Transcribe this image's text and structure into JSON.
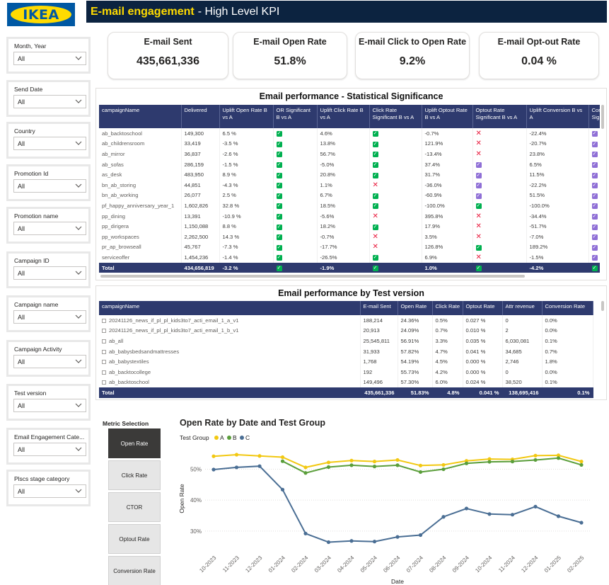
{
  "header": {
    "logo_text": "IKEA",
    "title_bold": "E-mail engagement",
    "title_rest": "- High Level KPI"
  },
  "slicers": [
    {
      "label": "Month, Year",
      "value": "All"
    },
    {
      "label": "Send Date",
      "value": "All"
    },
    {
      "label": "Country",
      "value": "All"
    },
    {
      "label": "Promotion Id",
      "value": "All"
    },
    {
      "label": "Promotion name",
      "value": "All"
    },
    {
      "label": "Campaign ID",
      "value": "All"
    },
    {
      "label": "Campaign name",
      "value": "All"
    },
    {
      "label": "Campaign Activity",
      "value": "All"
    },
    {
      "label": "Test version",
      "value": "All"
    },
    {
      "label": "Email Engagement Cate...",
      "value": "All"
    },
    {
      "label": "Plscs stage category",
      "value": "All"
    }
  ],
  "kpis": [
    {
      "label": "E-mail Sent",
      "value": "435,661,336"
    },
    {
      "label": "E-mail Open Rate",
      "value": "51.8%"
    },
    {
      "label": "E-mail Click to Open Rate",
      "value": "9.2%"
    },
    {
      "label": "E-mail Opt-out Rate",
      "value": "0.04 %"
    }
  ],
  "stat_table": {
    "title": "Email performance - Statistical Significance",
    "headers": [
      "campaignName",
      "Delivered",
      "Uplift Open Rate B vs A",
      "OR Significant B vs A",
      "Uplift Click Rate B vs A",
      "Click Rate Significant B vs A",
      "Uplift Optout Rate B vs A",
      "Optout Rate Significant B vs A",
      "Uplift Conversion B vs A",
      "Conv Sign..."
    ],
    "rows": [
      [
        "ab_backtoschool",
        "149,300",
        "6.5 %",
        "g",
        "4.6%",
        "g",
        "-0.7%",
        "x",
        "-22.4%",
        "p"
      ],
      [
        "ab_childrensroom",
        "33,419",
        "-3.5 %",
        "g",
        "13.8%",
        "g",
        "121.9%",
        "x",
        "-20.7%",
        "p"
      ],
      [
        "ab_mirror",
        "36,837",
        "-2.6 %",
        "g",
        "56.7%",
        "g",
        "-13.4%",
        "x",
        "23.8%",
        "p"
      ],
      [
        "ab_sofas",
        "286,159",
        "-1.5 %",
        "g",
        "-5.0%",
        "g",
        "37.4%",
        "p",
        "6.5%",
        "p"
      ],
      [
        "as_desk",
        "483,950",
        "8.9 %",
        "g",
        "20.8%",
        "g",
        "31.7%",
        "p",
        "11.5%",
        "p"
      ],
      [
        "bn_ab_storing",
        "44,851",
        "-4.3 %",
        "g",
        "1.1%",
        "x",
        "-36.0%",
        "p",
        "-22.2%",
        "p"
      ],
      [
        "bn_ab_working",
        "26,077",
        "2.5 %",
        "g",
        "6.7%",
        "g",
        "-60.9%",
        "p",
        "51.5%",
        "p"
      ],
      [
        "pf_happy_anniversary_year_1",
        "1,602,826",
        "32.8 %",
        "g",
        "18.5%",
        "g",
        "-100.0%",
        "g",
        "-100.0%",
        "p"
      ],
      [
        "pp_dining",
        "13,391",
        "-10.9 %",
        "g",
        "-5.6%",
        "x",
        "395.8%",
        "x",
        "-34.4%",
        "p"
      ],
      [
        "pp_dirigera",
        "1,150,088",
        "8.8 %",
        "g",
        "18.2%",
        "g",
        "17.9%",
        "x",
        "-51.7%",
        "p"
      ],
      [
        "pp_workspaces",
        "2,262,500",
        "14.3 %",
        "g",
        "-0.7%",
        "x",
        "3.5%",
        "x",
        "-7.0%",
        "p"
      ],
      [
        "pr_ap_browseall",
        "45,767",
        "-7.3 %",
        "g",
        "-17.7%",
        "x",
        "126.8%",
        "g",
        "189.2%",
        "p"
      ],
      [
        "serviceoffer",
        "1,454,236",
        "-1.4 %",
        "g",
        "-26.5%",
        "g",
        "6.9%",
        "x",
        "-1.5%",
        "p"
      ]
    ],
    "total": [
      "Total",
      "434,656,819",
      "-3.2 %",
      "g",
      "-1.9%",
      "g",
      "1.0%",
      "g",
      "-4.2%",
      "g"
    ]
  },
  "test_table": {
    "title": "Email performance by Test version",
    "headers": [
      "campaignName",
      "E-mail Sent",
      "Open Rate",
      "Click Rate",
      "Optout Rate",
      "Attr revenue",
      "Conversion Rate"
    ],
    "rows": [
      [
        "20241126_news_if_pl_pl_kids3to7_acti_email_1_a_v1",
        "188,214",
        "24.36%",
        "0.5%",
        "0.027 %",
        "0",
        "0.0%"
      ],
      [
        "20241126_news_if_pl_pl_kids3to7_acti_email_1_b_v1",
        "20,913",
        "24.09%",
        "0.7%",
        "0.010 %",
        "2",
        "0.0%"
      ],
      [
        "ab_all",
        "25,545,811",
        "56.91%",
        "3.3%",
        "0.035 %",
        "6,030,081",
        "0.1%"
      ],
      [
        "ab_babysbedsandmattresses",
        "31,933",
        "57.82%",
        "4.7%",
        "0.041 %",
        "34,685",
        "0.7%"
      ],
      [
        "ab_babystextiles",
        "1,768",
        "54.19%",
        "4.5%",
        "0.000 %",
        "2,746",
        "1.8%"
      ],
      [
        "ab_backtocollege",
        "192",
        "55.73%",
        "4.2%",
        "0.000 %",
        "0",
        "0.0%"
      ],
      [
        "ab_backtoschool",
        "149,496",
        "57.30%",
        "6.0%",
        "0.024 %",
        "38,520",
        "0.1%"
      ]
    ],
    "total": [
      "Total",
      "435,661,336",
      "51.83%",
      "4.8%",
      "0.041 %",
      "138,695,416",
      "0.1%"
    ]
  },
  "metric_selection": {
    "title": "Metric Selection",
    "buttons": [
      "Open Rate",
      "Click Rate",
      "CTOR",
      "Optout Rate",
      "Conversion Rate"
    ],
    "selected": "Open Rate"
  },
  "chart_data": {
    "type": "line",
    "title": "Open Rate by Date and Test Group",
    "legend_title": "Test Group",
    "legend_position": "top-left",
    "xlabel": "Date",
    "ylabel": "Open Rate",
    "x": [
      "10-2023",
      "11-2023",
      "12-2023",
      "01-2024",
      "02-2024",
      "03-2024",
      "04-2024",
      "05-2024",
      "06-2024",
      "07-2024",
      "08-2024",
      "09-2024",
      "10-2024",
      "11-2024",
      "12-2024",
      "01-2025",
      "02-2025"
    ],
    "y_ticks": [
      "30%",
      "40%",
      "50%"
    ],
    "ylim": [
      24,
      57
    ],
    "grid": true,
    "series": [
      {
        "name": "A",
        "color": "#f2c811",
        "values": [
          54.2,
          54.7,
          54.3,
          53.9,
          50.6,
          52.2,
          52.8,
          52.5,
          53.0,
          51.2,
          51.4,
          52.7,
          53.3,
          53.2,
          54.4,
          54.5,
          52.5
        ]
      },
      {
        "name": "B",
        "color": "#5a9e3a",
        "values": [
          null,
          null,
          null,
          52.6,
          48.8,
          50.7,
          51.3,
          50.9,
          51.3,
          49.1,
          50.0,
          51.9,
          52.4,
          52.5,
          53.0,
          53.6,
          51.4
        ]
      },
      {
        "name": "C",
        "color": "#4a6e94",
        "values": [
          49.9,
          50.6,
          51.0,
          43.4,
          29.2,
          26.4,
          26.8,
          26.6,
          28.1,
          28.7,
          34.6,
          37.3,
          35.5,
          35.3,
          37.9,
          34.8,
          32.7
        ]
      }
    ]
  }
}
